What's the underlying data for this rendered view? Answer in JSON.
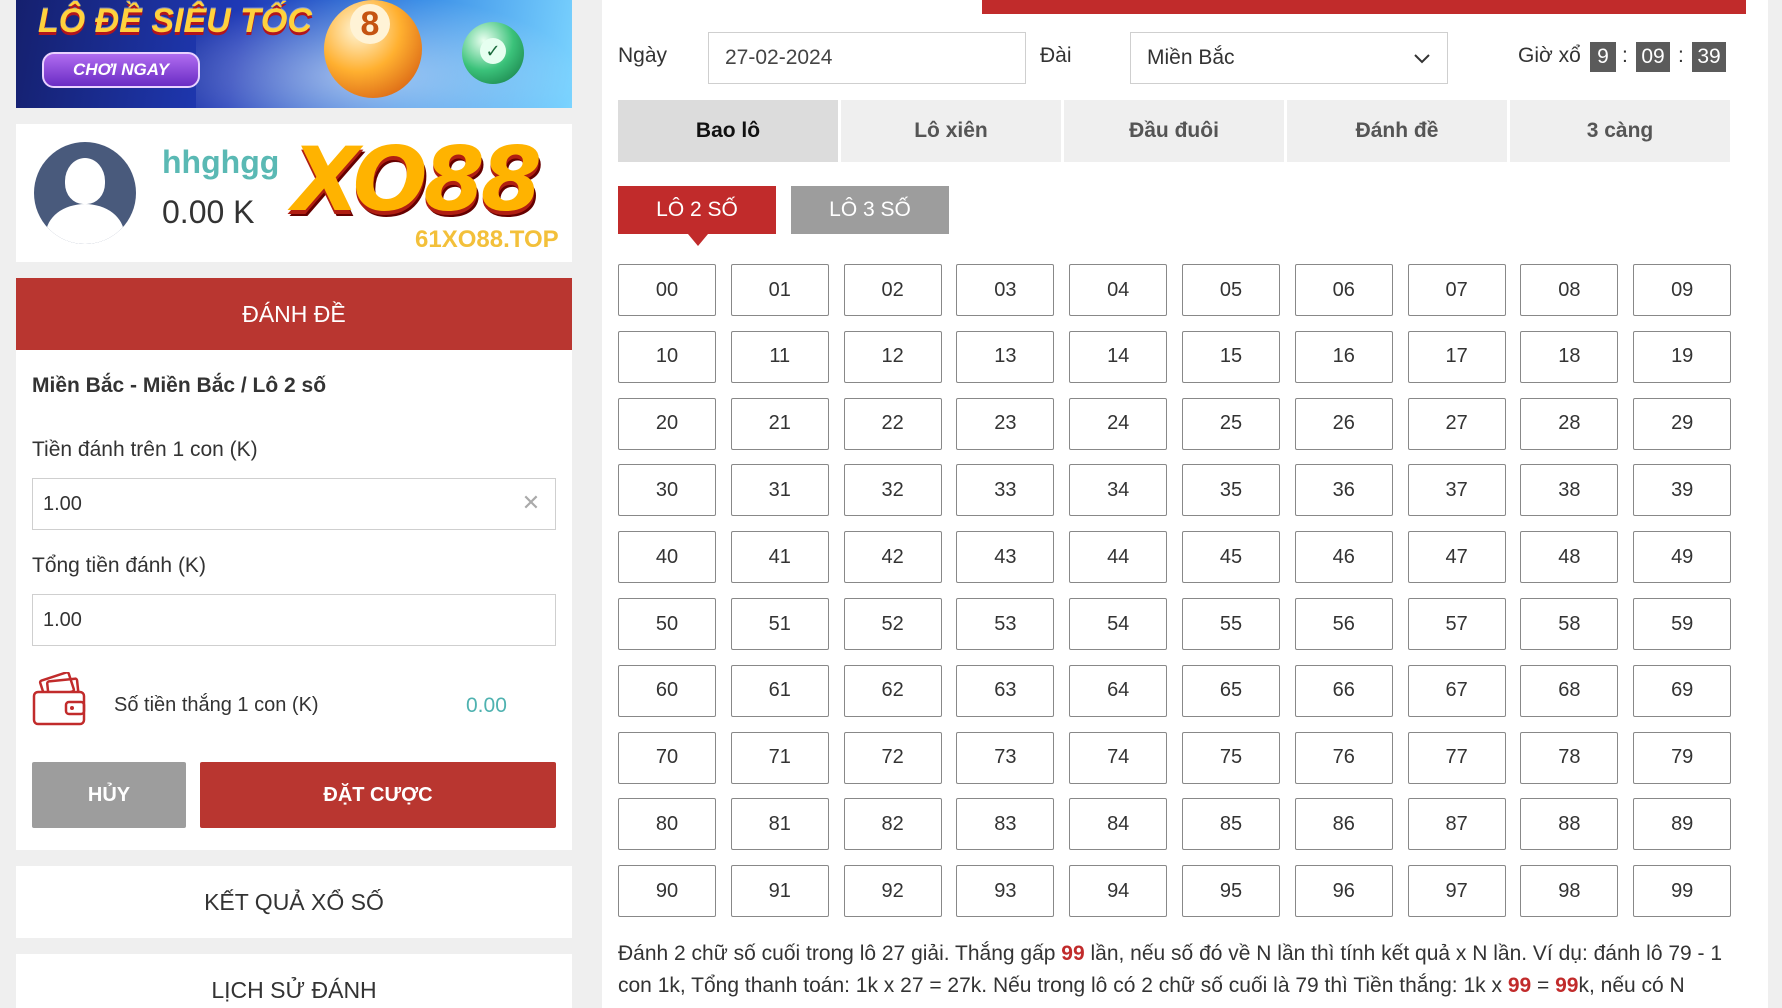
{
  "banner": {
    "title": "LÔ ĐỀ SIÊU TỐC",
    "cta": "CHƠI NGAY",
    "ball_number": "8"
  },
  "profile": {
    "username": "hhghgg",
    "balance": "0.00 K",
    "brand_logo": "XO88",
    "brand_site": "61XO88.TOP"
  },
  "bet_form": {
    "header": "ĐÁNH ĐỀ",
    "path": "Miền Bắc - Miền Bắc / Lô 2 số",
    "stake_label": "Tiền đánh trên 1 con (K)",
    "stake_value": "1.00",
    "total_label": "Tổng tiền đánh (K)",
    "total_value": "1.00",
    "win_label": "Số tiền thắng 1 con (K)",
    "win_value": "0.00",
    "cancel": "HỦY",
    "submit": "ĐẶT CƯỢC"
  },
  "links": {
    "results": "KẾT QUẢ XỔ SỐ",
    "history": "LỊCH SỬ ĐÁNH"
  },
  "controls": {
    "date_label": "Ngày",
    "date_value": "27-02-2024",
    "region_label": "Đài",
    "region_value": "Miền Bắc",
    "draw_label": "Giờ xổ",
    "draw_h": "9",
    "draw_m": "09",
    "draw_s": "39",
    "sep": ":"
  },
  "tabs": [
    "Bao lô",
    "Lô xiên",
    "Đầu đuôi",
    "Đánh đề",
    "3 càng"
  ],
  "subtabs": [
    "LÔ 2 SỐ",
    "LÔ 3 SỐ"
  ],
  "numbers": [
    "00",
    "01",
    "02",
    "03",
    "04",
    "05",
    "06",
    "07",
    "08",
    "09",
    "10",
    "11",
    "12",
    "13",
    "14",
    "15",
    "16",
    "17",
    "18",
    "19",
    "20",
    "21",
    "22",
    "23",
    "24",
    "25",
    "26",
    "27",
    "28",
    "29",
    "30",
    "31",
    "32",
    "33",
    "34",
    "35",
    "36",
    "37",
    "38",
    "39",
    "40",
    "41",
    "42",
    "43",
    "44",
    "45",
    "46",
    "47",
    "48",
    "49",
    "50",
    "51",
    "52",
    "53",
    "54",
    "55",
    "56",
    "57",
    "58",
    "59",
    "60",
    "61",
    "62",
    "63",
    "64",
    "65",
    "66",
    "67",
    "68",
    "69",
    "70",
    "71",
    "72",
    "73",
    "74",
    "75",
    "76",
    "77",
    "78",
    "79",
    "80",
    "81",
    "82",
    "83",
    "84",
    "85",
    "86",
    "87",
    "88",
    "89",
    "90",
    "91",
    "92",
    "93",
    "94",
    "95",
    "96",
    "97",
    "98",
    "99"
  ],
  "description": {
    "p1": "Đánh 2 chữ số cuối trong lô 27 giải. Thắng gấp ",
    "h1": "99",
    "p2": " lần, nếu số đó về N lần thì tính kết quả x N lần. Ví dụ: đánh lô 79 - 1 con 1k, Tổng thanh toán: 1k x 27 = 27k. Nếu trong lô có 2 chữ số cuối là 79 thì Tiền thắng: 1k x ",
    "h2": "99",
    "p3": " = ",
    "h3": "99",
    "p4": "k, nếu có N"
  },
  "colors": {
    "primary_red": "#c12b2b",
    "teal": "#5ab9b4",
    "gray_button": "#9d9d9d"
  }
}
